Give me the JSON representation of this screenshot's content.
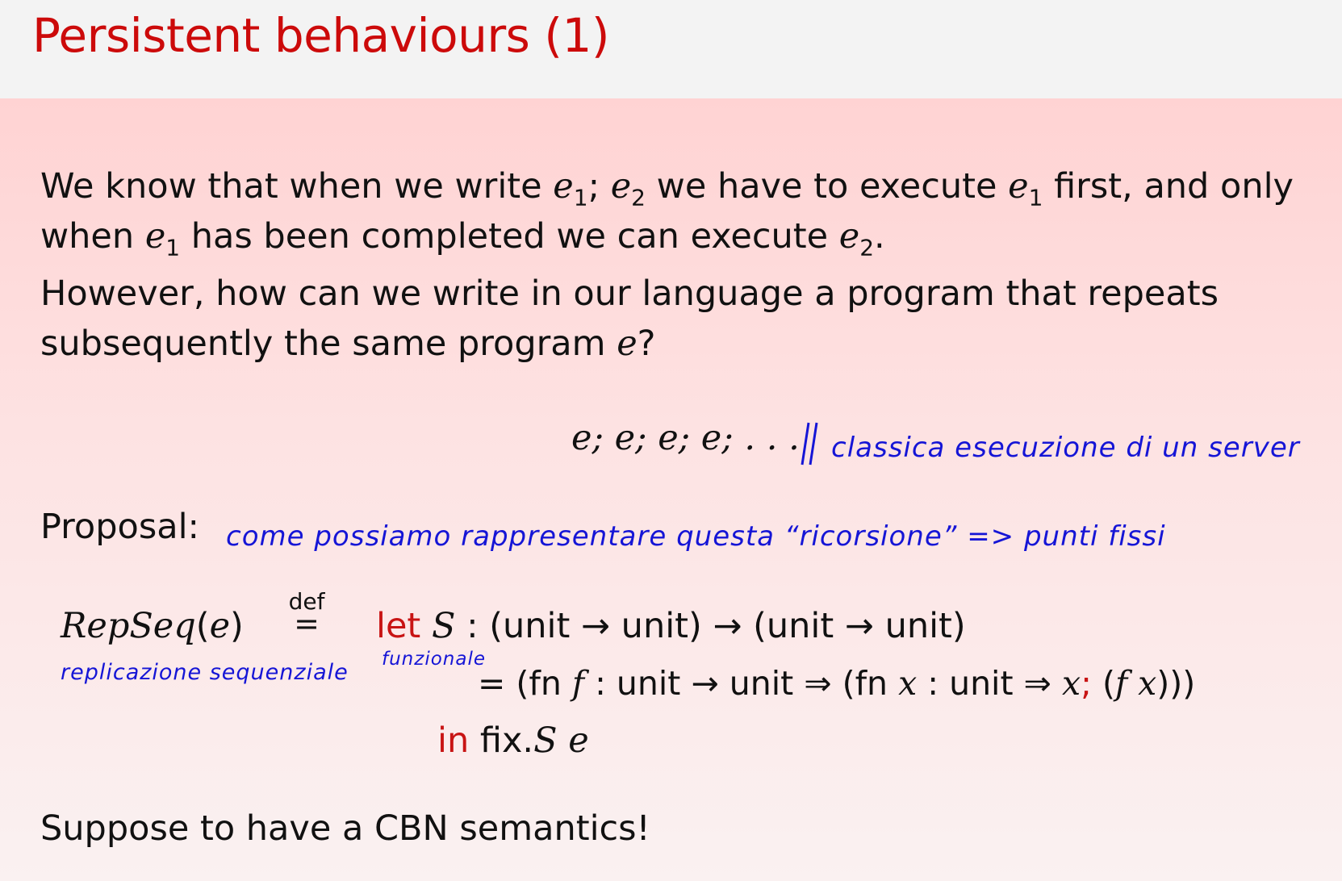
{
  "slide": {
    "title": "Persistent behaviours (1)",
    "para1_line1": {
      "a": "We know that when we write ",
      "e": "e",
      "s1": "1",
      "semi": "; ",
      "e2": "e",
      "s2": "2",
      "b": " we have to execute ",
      "e3": "e",
      "s3": "1",
      "c": " first, and only"
    },
    "para1_line2": {
      "a": "when ",
      "e": "e",
      "s1": "1",
      "b": " has been completed we can execute ",
      "e2": "e",
      "s2": "2",
      "c": "."
    },
    "para2_line1": "However, how can we write in our language a program that repeats",
    "para2_line2": {
      "a": "subsequently the same program ",
      "e": "e",
      "q": "?"
    },
    "sequence": "e; e; e; e; . . .",
    "proposal_label": "Proposal:",
    "repseq": {
      "name": "RepSeq",
      "open": "(",
      "arg": "e",
      "close": ")"
    },
    "def_label": "def",
    "def_eq": "=",
    "let_kw": "let",
    "let_line": {
      "S": "S",
      "rest": " : (unit → unit) → (unit → unit)"
    },
    "eq_line": {
      "eq": "= ",
      "a": "(fn ",
      "f": "f",
      "b": " : unit → unit ⇒ (fn ",
      "x": "x",
      "c": " : unit ⇒ ",
      "x2": "x",
      "semi": ";",
      "d": " (",
      "f2": "f",
      "e": " ",
      "x3": "x",
      "g": ")))"
    },
    "in_kw": "in",
    "in_line": {
      "fix": " fix.",
      "S": "S",
      "e": " e"
    },
    "footer": "Suppose to have a CBN semantics!"
  },
  "handwriting": {
    "server_note": "classica esecuzione di un server",
    "proposal_note": "come possiamo rappresentare questa “ricorsione” => punti fissi",
    "repseq_note": "replicazione sequenziale",
    "functional_note": "funzionale"
  },
  "colors": {
    "title": "#cc0a0a",
    "keyword": "#c81414",
    "ink": "#1515d6"
  }
}
